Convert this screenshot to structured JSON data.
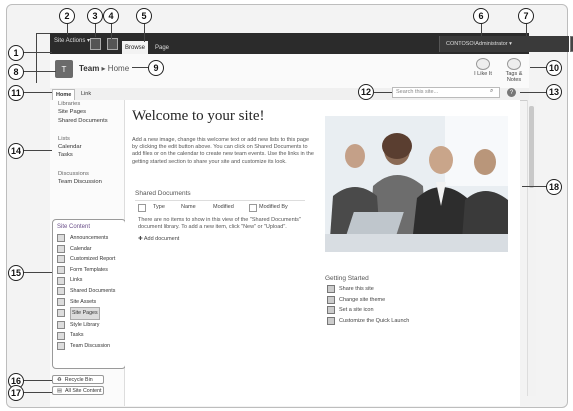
{
  "ribbon": {
    "site_actions": "Site Actions ▾",
    "tabs": [
      {
        "label": "Browse"
      },
      {
        "label": "Page"
      }
    ],
    "user": "CONTOSO\\Administrator ▾"
  },
  "title_row": {
    "logo_initials": "T",
    "site": "Team",
    "separator": "▸",
    "page": "Home",
    "like_it": "I Like It",
    "tags_notes": "Tags & Notes"
  },
  "top_nav": {
    "items": [
      "Home",
      "Link"
    ],
    "search_placeholder": "Search this site...",
    "help": "?"
  },
  "quick_launch": {
    "libraries_header": "Libraries",
    "libraries": [
      "Site Pages",
      "Shared Documents"
    ],
    "lists_header": "Lists",
    "lists": [
      "Calendar",
      "Tasks"
    ],
    "discussions_header": "Discussions",
    "discussions": [
      "Team Discussion"
    ]
  },
  "site_content": {
    "header": "Site Content",
    "items": [
      "Announcements",
      "Calendar",
      "Customized Report",
      "Form Templates",
      "Links",
      "Shared Documents",
      "Site Assets",
      "Site Pages",
      "Style Library",
      "Tasks",
      "Team Discussion"
    ],
    "selected": "Site Pages"
  },
  "footer_links": {
    "recycle_bin": "Recycle Bin",
    "all_site_content": "All Site Content"
  },
  "main": {
    "welcome": "Welcome to your site!",
    "intro": "Add a new image, change this welcome text or add new lists to this page by clicking the edit button above. You can click on Shared Documents to add files or on the calendar to create new team events. Use the links in the getting started section to share your site and customize its look.",
    "docs_header": "Shared Documents",
    "columns": [
      "Type",
      "Name",
      "Modified",
      "Modified By"
    ],
    "empty_text": "There are no items to show in this view of the \"Shared Documents\" document library. To add a new item, click \"New\" or \"Upload\".",
    "add_document": "Add document",
    "getting_started_header": "Getting Started",
    "getting_started": [
      "Share this site",
      "Change site theme",
      "Set a site icon",
      "Customize the Quick Launch"
    ]
  },
  "callouts": [
    "1",
    "2",
    "3",
    "4",
    "5",
    "6",
    "7",
    "8",
    "9",
    "10",
    "11",
    "12",
    "13",
    "14",
    "15",
    "16",
    "17",
    "18"
  ]
}
